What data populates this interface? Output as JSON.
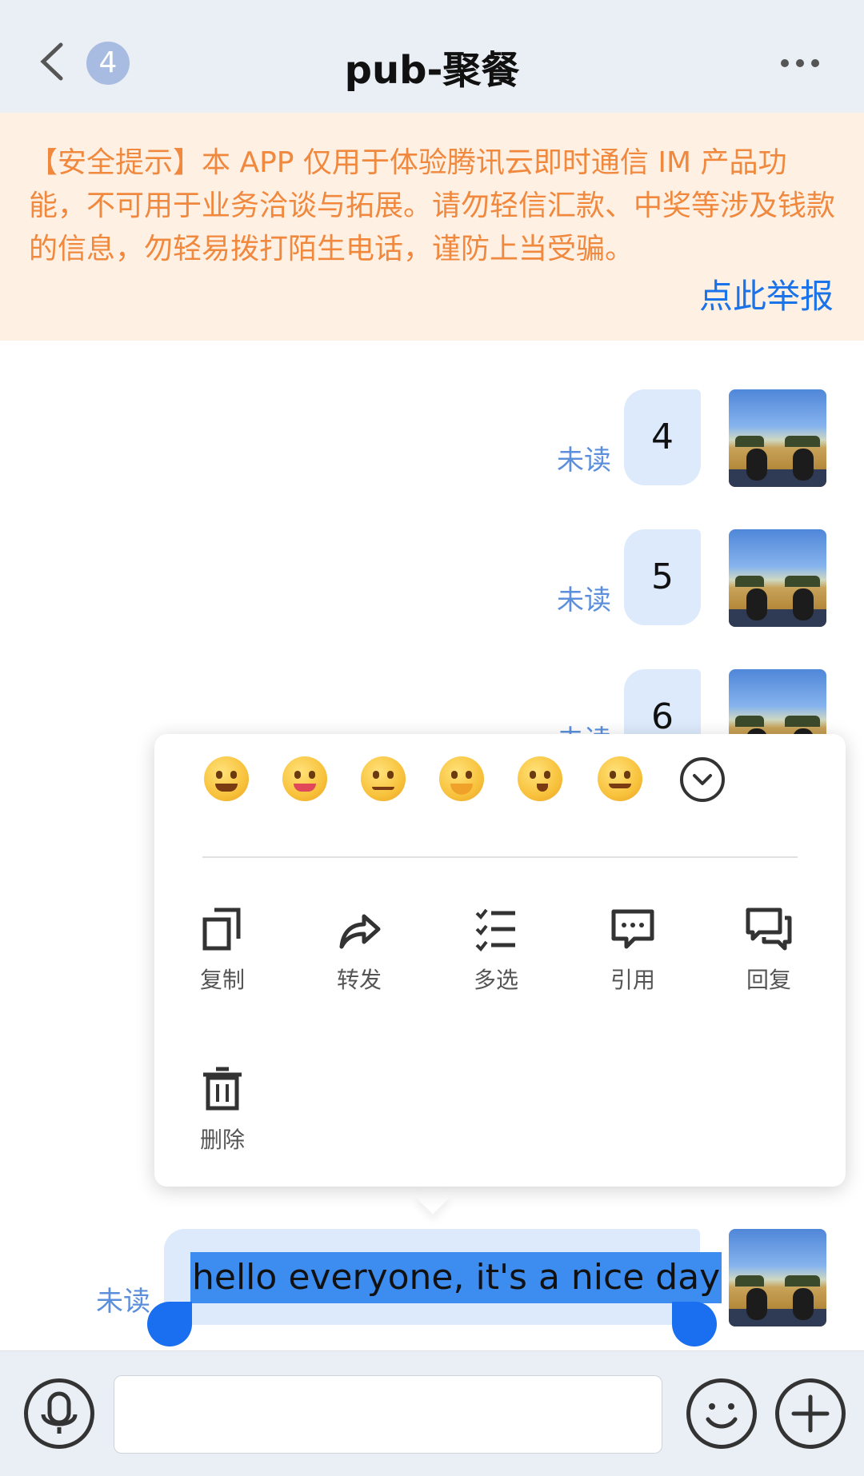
{
  "header": {
    "title": "pub-聚餐",
    "unread_badge": "4",
    "back_icon": "chevron-left-icon",
    "more_icon": "more-dots-icon"
  },
  "notice": {
    "text": "【安全提示】本 APP 仅用于体验腾讯云即时通信 IM 产品功能，不可用于业务洽谈与拓展。请勿轻信汇款、中奖等涉及钱款的信息，勿轻易拨打陌生电话，谨防上当受骗。",
    "report_link": "点此举报",
    "text_color": "#f0883e",
    "link_color": "#1a73e8"
  },
  "messages": [
    {
      "text": "4",
      "status": "未读"
    },
    {
      "text": "5",
      "status": "未读"
    },
    {
      "text": "6",
      "status": "未读"
    }
  ],
  "selected_message": {
    "text": "hello everyone, it's a nice day",
    "status": "未读"
  },
  "context_menu": {
    "reactions": [
      "grin-emoji",
      "tongue-wink-emoji",
      "sweat-emoji",
      "cover-mouth-emoji",
      "thinking-emoji",
      "hammer-emoji"
    ],
    "expand_icon": "chevron-circle-down-icon",
    "actions": [
      {
        "label": "复制",
        "icon": "copy-icon"
      },
      {
        "label": "转发",
        "icon": "forward-icon"
      },
      {
        "label": "多选",
        "icon": "multi-select-icon"
      },
      {
        "label": "引用",
        "icon": "quote-icon"
      },
      {
        "label": "回复",
        "icon": "reply-icon"
      },
      {
        "label": "删除",
        "icon": "delete-icon"
      }
    ]
  },
  "input_bar": {
    "voice_icon": "microphone-icon",
    "emoji_icon": "smiley-icon",
    "plus_icon": "plus-icon",
    "value": ""
  },
  "colors": {
    "accent": "#1a6ef0",
    "bubble": "#dceafc",
    "selection": "#3d8cf0",
    "unread": "#5b8fdb"
  }
}
